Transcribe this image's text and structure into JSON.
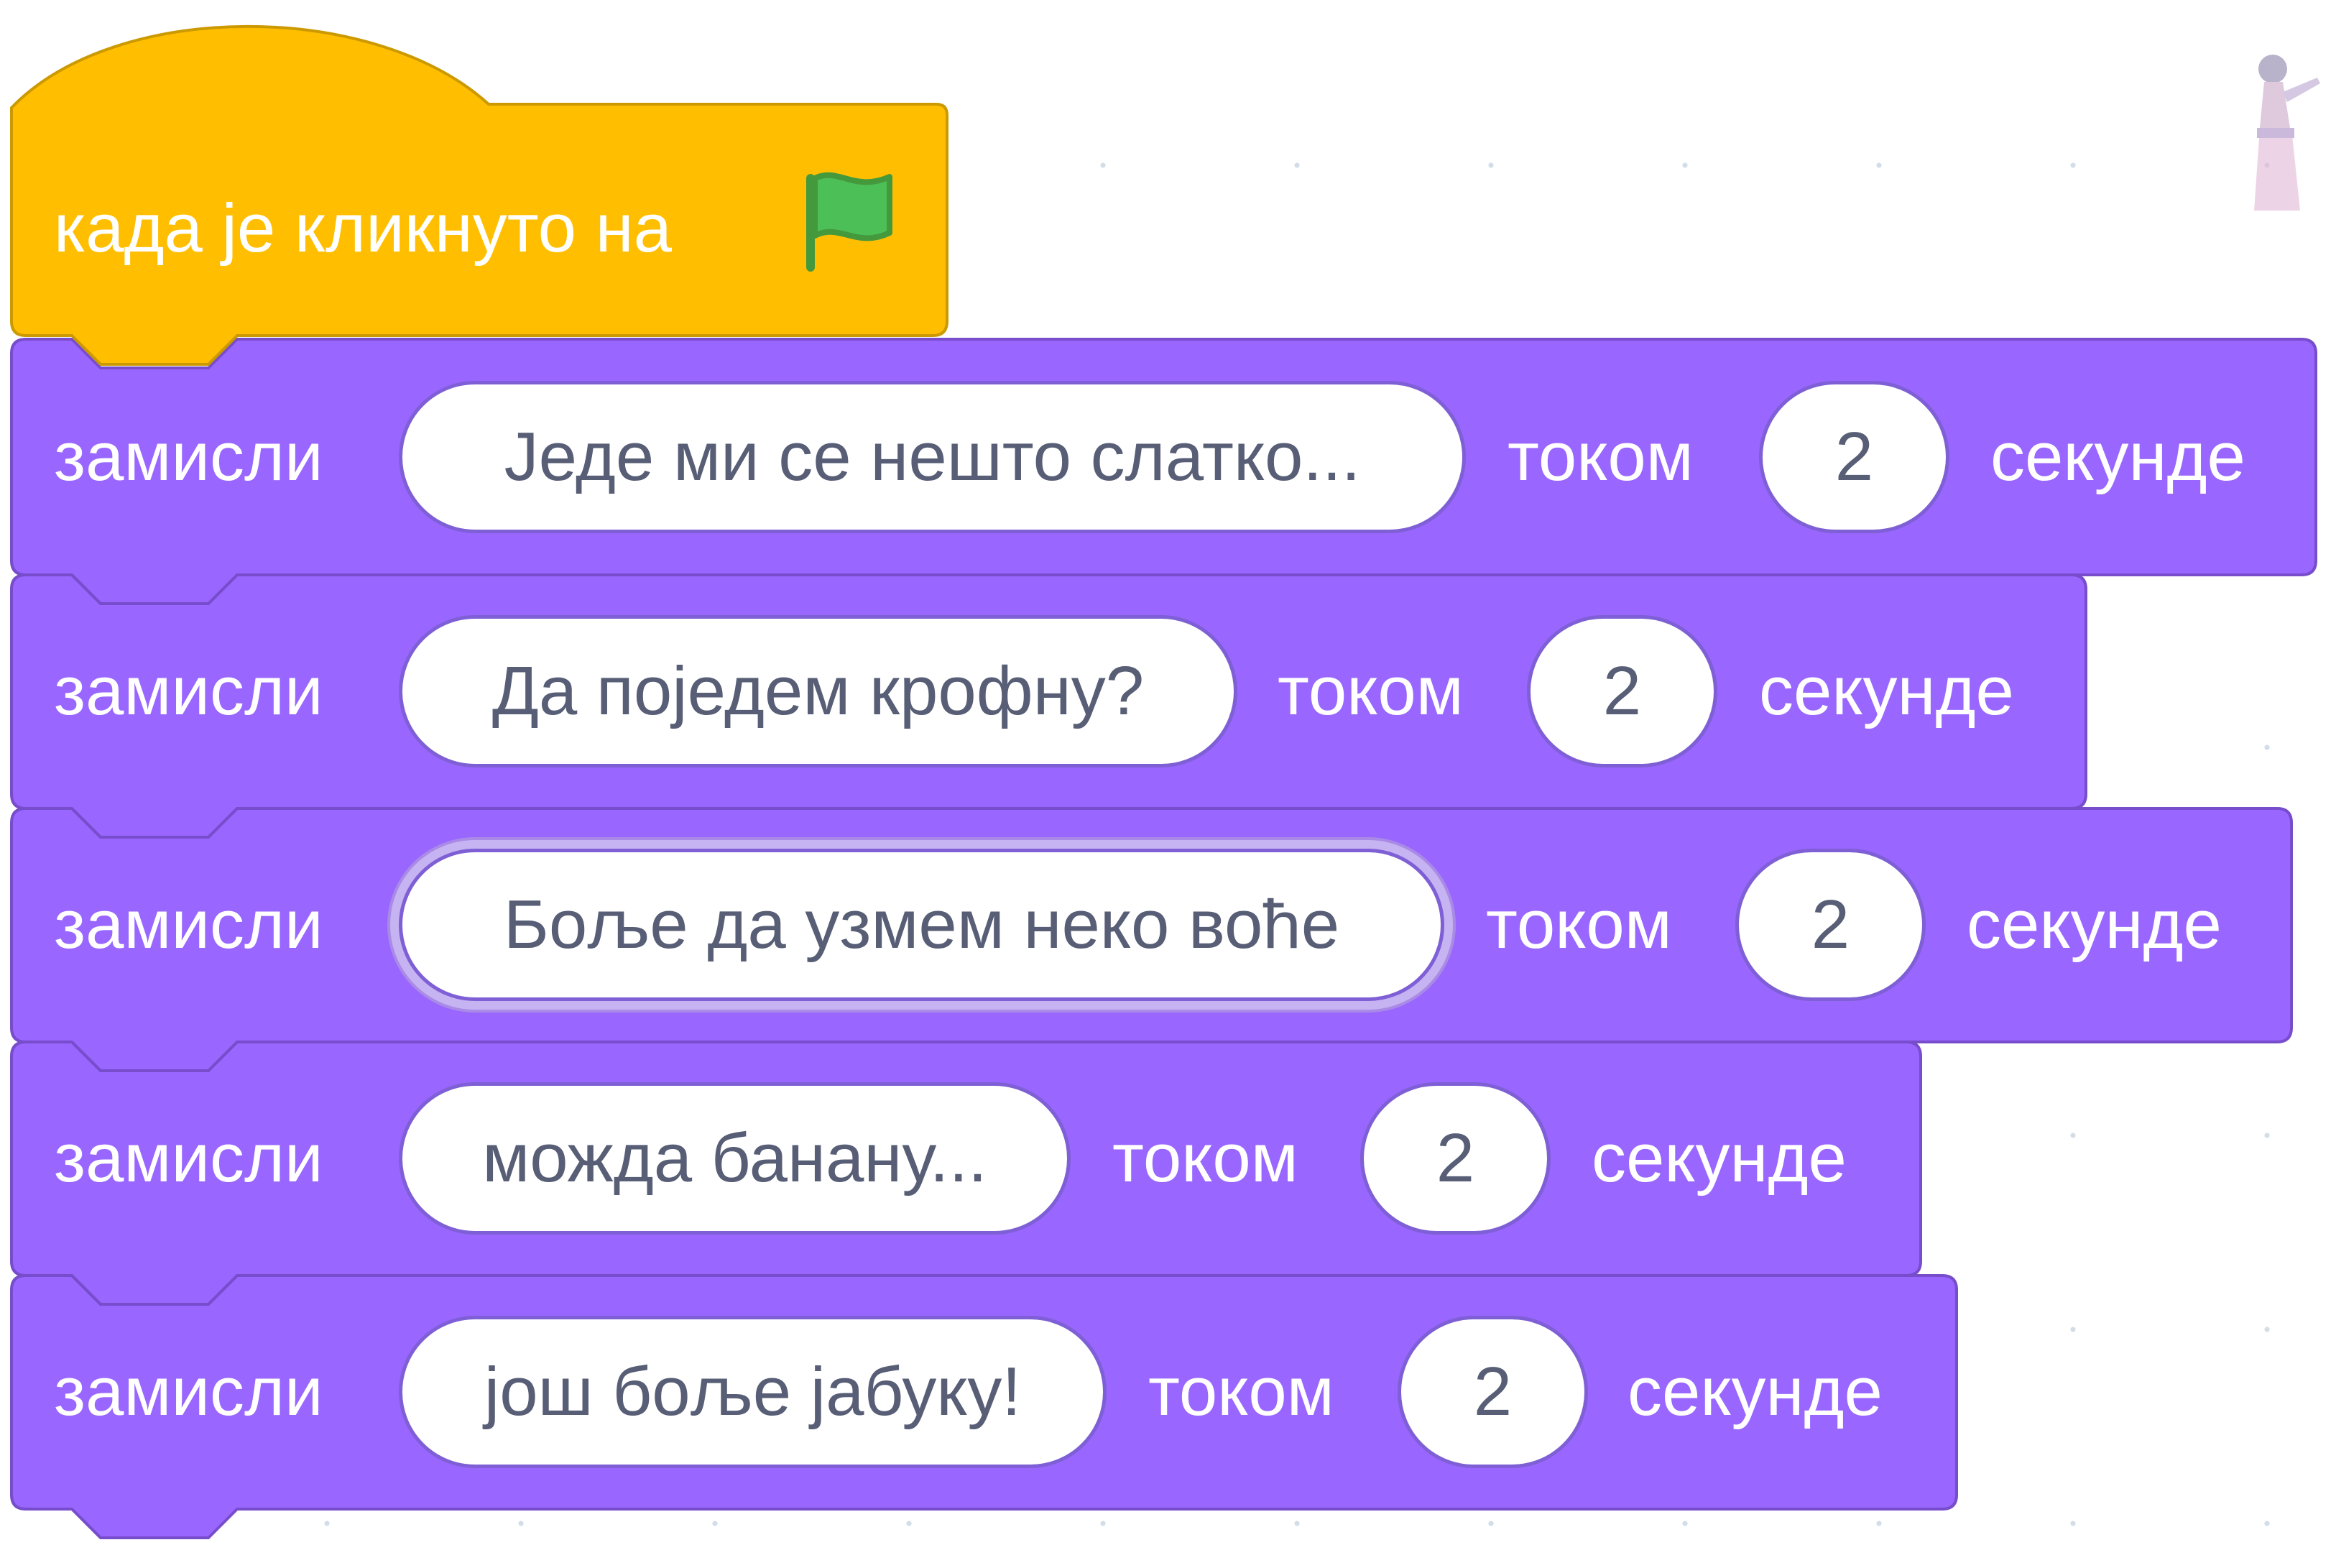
{
  "hat_block": {
    "label": "када је кликнуто на",
    "icon": "green-flag-icon",
    "color": "#ffbf00"
  },
  "think_blocks": [
    {
      "verb": "замисли",
      "message": "Једе ми се нешто слатко...",
      "for_label": "током",
      "seconds": "2",
      "unit": "секунде"
    },
    {
      "verb": "замисли",
      "message": "Да поједем крофну?",
      "for_label": "током",
      "seconds": "2",
      "unit": "секунде"
    },
    {
      "verb": "замисли",
      "message": "Боље да узмем неко воће",
      "for_label": "током",
      "seconds": "2",
      "unit": "секунде",
      "selected": true
    },
    {
      "verb": "замисли",
      "message": "можда банану...",
      "for_label": "током",
      "seconds": "2",
      "unit": "секунде"
    },
    {
      "verb": "замисли",
      "message": "још боље јабуку!",
      "for_label": "током",
      "seconds": "2",
      "unit": "секунде"
    }
  ],
  "colors": {
    "looks_block": "#9966ff",
    "looks_block_border": "#774dcb",
    "events_block": "#ffbf00",
    "events_block_border": "#cc9900",
    "input_text": "#575e75",
    "flag_green": "#4cbf56"
  },
  "sprite_icon": "sprite-thumbnail-icon"
}
